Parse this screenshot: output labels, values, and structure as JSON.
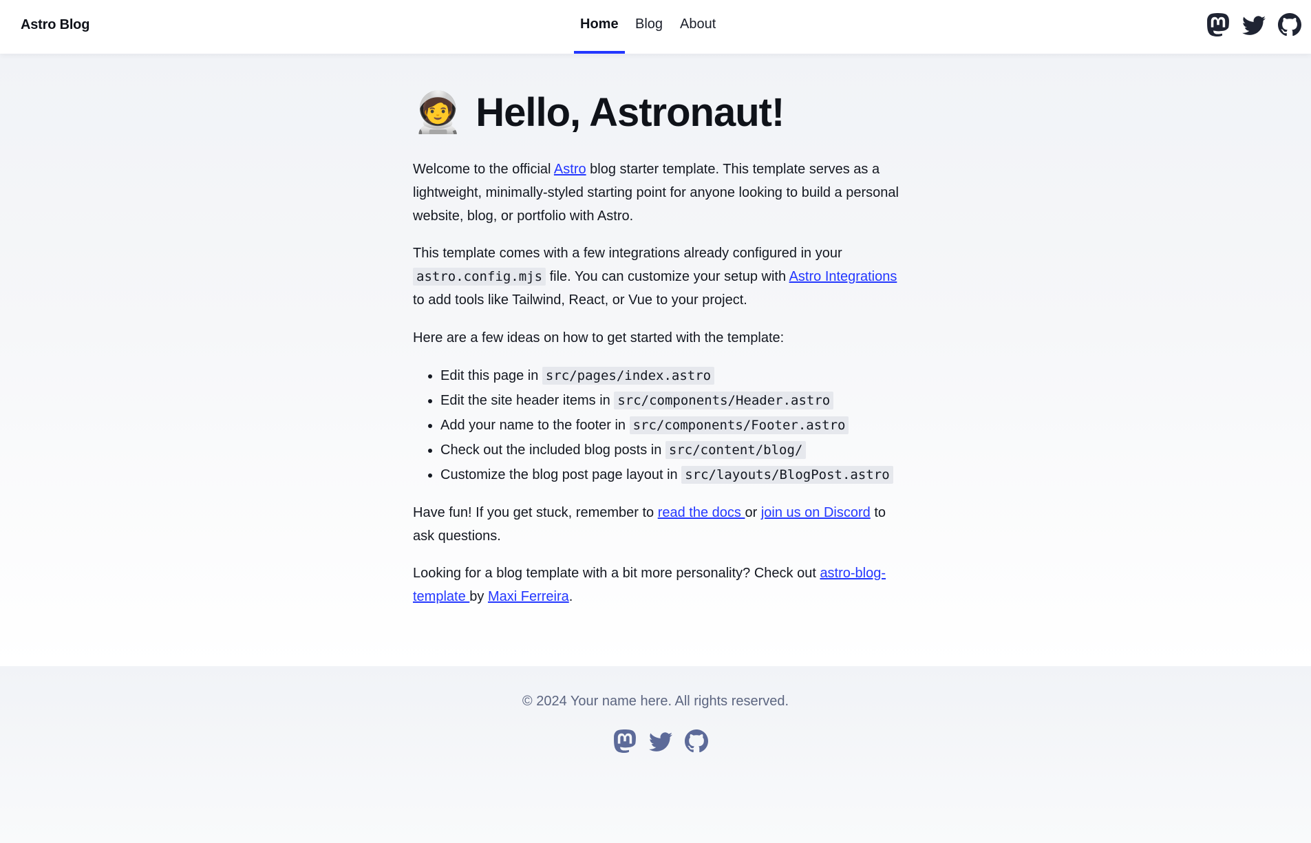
{
  "header": {
    "brand": "Astro Blog",
    "nav": [
      {
        "label": "Home",
        "active": true
      },
      {
        "label": "Blog",
        "active": false
      },
      {
        "label": "About",
        "active": false
      }
    ],
    "social_icons": [
      "mastodon-icon",
      "twitter-icon",
      "github-icon"
    ]
  },
  "main": {
    "title": "Hello, Astronaut!",
    "title_emoji": "🧑‍🚀",
    "intro": {
      "before": "Welcome to the official ",
      "link": "Astro",
      "after": " blog starter template. This template serves as a lightweight, minimally-styled starting point for anyone looking to build a personal website, blog, or portfolio with Astro."
    },
    "integrations": {
      "before": "This template comes with a few integrations already configured in your ",
      "code": "astro.config.mjs",
      "middle": " file. You can customize your setup with ",
      "link": "Astro Integrations",
      "after": " to add tools like Tailwind, React, or Vue to your project."
    },
    "ideas_heading": "Here are a few ideas on how to get started with the template:",
    "ideas": [
      {
        "text": "Edit this page in ",
        "code": "src/pages/index.astro"
      },
      {
        "text": "Edit the site header items in ",
        "code": "src/components/Header.astro"
      },
      {
        "text": "Add your name to the footer in ",
        "code": "src/components/Footer.astro"
      },
      {
        "text": "Check out the included blog posts in ",
        "code": "src/content/blog/"
      },
      {
        "text": "Customize the blog post page layout in ",
        "code": "src/layouts/BlogPost.astro"
      }
    ],
    "help": {
      "before": "Have fun! If you get stuck, remember to ",
      "link1": "read the docs ",
      "middle": "or ",
      "link2": "join us on Discord",
      "after": " to ask questions."
    },
    "personality": {
      "before": "Looking for a blog template with a bit more personality? Check out ",
      "link1": "astro-blog-template ",
      "middle": "by ",
      "link2": "Maxi Ferreira",
      "after": "."
    }
  },
  "footer": {
    "copyright": "© 2024 Your name here. All rights reserved.",
    "social_icons": [
      "mastodon-icon",
      "twitter-icon",
      "github-icon"
    ]
  },
  "colors": {
    "accent": "#2337ff",
    "text": "#141821",
    "footer_text": "#5c6580",
    "code_bg": "#e6e8ed"
  }
}
